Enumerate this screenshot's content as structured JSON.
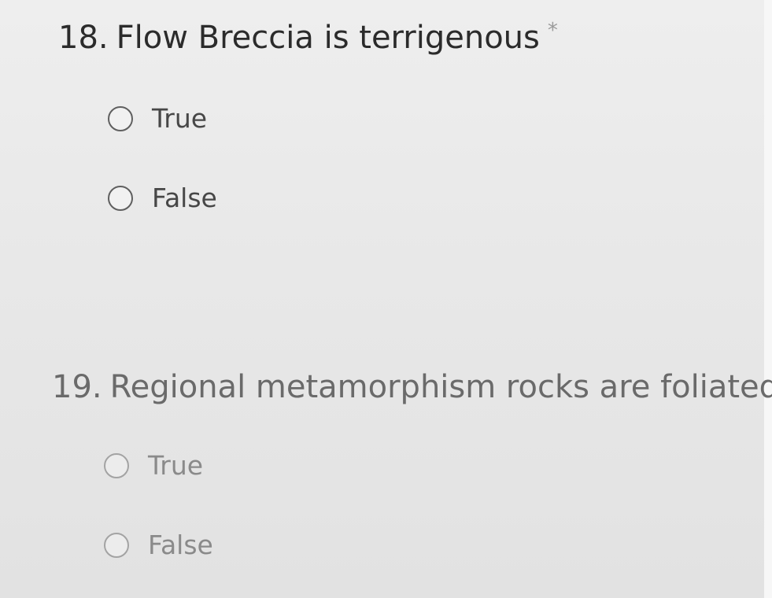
{
  "questions": [
    {
      "number": "18.",
      "text": "Flow Breccia is terrigenous",
      "required_marker": "*",
      "options": [
        {
          "label": "True",
          "selected": false
        },
        {
          "label": "False",
          "selected": false
        }
      ]
    },
    {
      "number": "19.",
      "text": "Regional metamorphism rocks are foliated",
      "required_marker": "*",
      "options": [
        {
          "label": "True",
          "selected": false
        },
        {
          "label": "False",
          "selected": false
        }
      ]
    }
  ],
  "colors": {
    "background": "#e9e9e9",
    "question_text": "#2b2b2b",
    "faded_question_text": "#6a6a6a",
    "required_marker": "#9a9a9a"
  }
}
